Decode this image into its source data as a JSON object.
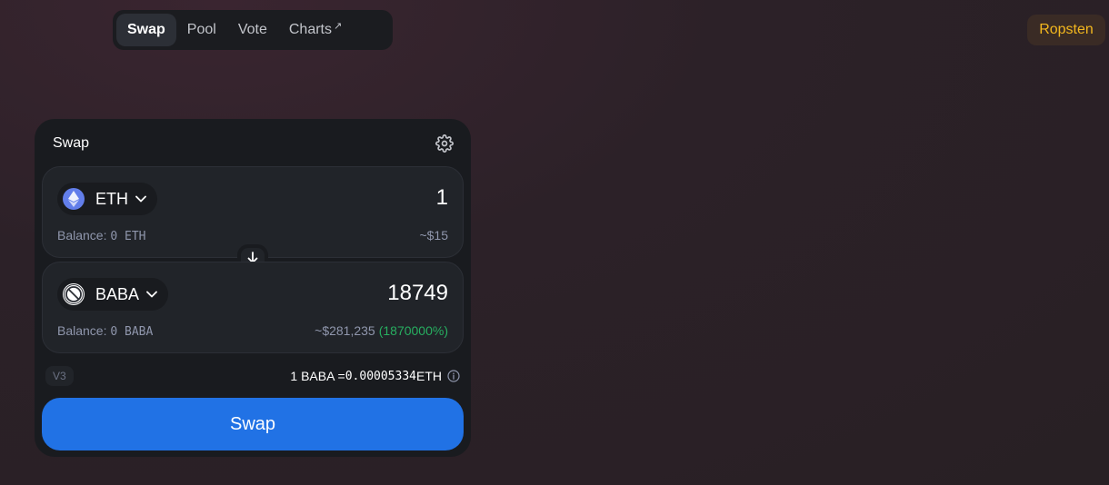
{
  "nav": {
    "items": [
      {
        "label": "Swap",
        "active": true
      },
      {
        "label": "Pool",
        "active": false
      },
      {
        "label": "Vote",
        "active": false
      },
      {
        "label": "Charts",
        "active": false,
        "external_marker": "↗"
      }
    ]
  },
  "network": {
    "label": "Ropsten",
    "color": "#f3b71e"
  },
  "swap_card": {
    "title": "Swap",
    "settings_icon": "gear-icon",
    "input": {
      "token_symbol": "ETH",
      "token_icon": "ethereum-icon",
      "amount": "1",
      "balance_label": "Balance:",
      "balance_value": "0 ETH",
      "fiat_value": "~$15"
    },
    "switch_icon": "arrow-down-icon",
    "output": {
      "token_symbol": "BABA",
      "token_icon": "baba-token-icon",
      "amount": "18749",
      "balance_label": "Balance:",
      "balance_value": "0 BABA",
      "fiat_value": "~$281,235",
      "price_impact": "(1870000%)"
    },
    "version_badge": "V3",
    "rate": {
      "prefix": "1 BABA = ",
      "value": "0.00005334",
      "suffix": " ETH"
    },
    "swap_button_label": "Swap"
  },
  "colors": {
    "accent": "#2172e5",
    "positive": "#27ae60",
    "card": "#191b1f",
    "panel": "#212429"
  }
}
